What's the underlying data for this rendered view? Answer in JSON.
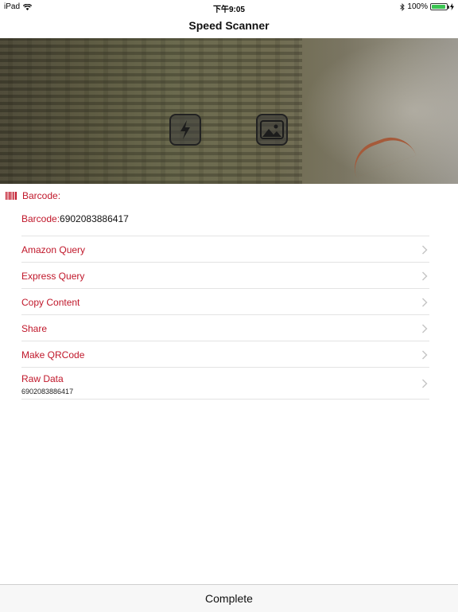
{
  "status": {
    "device": "iPad",
    "time": "下午9:05",
    "battery": "100%"
  },
  "nav": {
    "title": "Speed Scanner"
  },
  "camera": {
    "flash_icon": "flash-icon",
    "photo_icon": "photo-library-icon"
  },
  "section": {
    "icon": "barcode-icon",
    "label": "Barcode:"
  },
  "barcode": {
    "key": "Barcode:",
    "value": "6902083886417"
  },
  "actions": [
    {
      "label": "Amazon Query"
    },
    {
      "label": "Express Query"
    },
    {
      "label": "Copy Content"
    },
    {
      "label": "Share"
    },
    {
      "label": "Make QRCode"
    },
    {
      "label": "Raw Data",
      "sub": "6902083886417"
    }
  ],
  "footer": {
    "complete_label": "Complete"
  },
  "colors": {
    "accent": "#c0172a",
    "battery": "#3bc552"
  }
}
